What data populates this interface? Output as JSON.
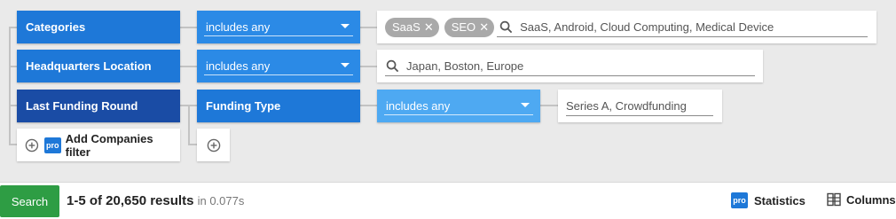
{
  "filters": {
    "categories": {
      "field_label": "Categories",
      "operator": "includes any",
      "chips": [
        "SaaS",
        "SEO"
      ],
      "placeholder": "SaaS, Android, Cloud Computing, Medical Device"
    },
    "headquarters": {
      "field_label": "Headquarters Location",
      "operator": "includes any",
      "placeholder": "Japan, Boston, Europe"
    },
    "funding": {
      "field_label": "Last Funding Round",
      "sub_field_label": "Funding Type",
      "operator": "includes any",
      "placeholder": "Series A, Crowdfunding"
    },
    "add_filter": {
      "pro_badge": "pro",
      "label": "Add Companies filter"
    }
  },
  "results_bar": {
    "search_label": "Search",
    "results_text": "1-5 of 20,650 results",
    "time_text": "in 0.077s",
    "statistics_pro_badge": "pro",
    "statistics_label": "Statistics",
    "columns_label": "Columns"
  },
  "colors": {
    "field_blue": "#1e78d8",
    "field_dark_blue": "#1a4ca5",
    "operator_blue": "#2b8ae6",
    "operator_light_blue": "#4ea9f2",
    "search_green": "#2e9d44",
    "chip_gray": "#a9a9a9"
  },
  "icons": {
    "chip_remove": "close-icon",
    "search": "search-icon",
    "add": "plus-circle-icon",
    "columns": "columns-icon"
  }
}
